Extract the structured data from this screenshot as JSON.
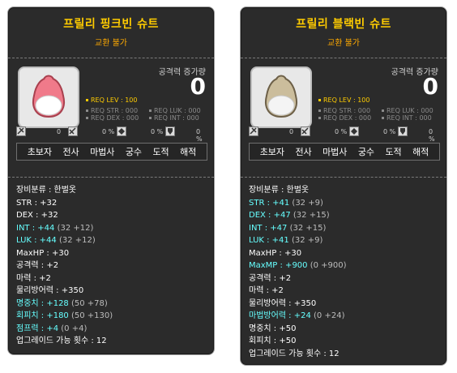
{
  "cards": [
    {
      "title": "프릴리 핑크빈 슈트",
      "trade": "교환 불가",
      "attack_label": "공격력 증가량",
      "attack_value": "0",
      "req_lev": "REQ LEV : 100",
      "req_str": "REQ STR : 000",
      "req_dex": "REQ DEX : 000",
      "req_luk": "REQ LUK : 000",
      "req_int": "REQ INT : 000",
      "icon_values": [
        "0",
        "0 %",
        "0 %",
        "0 %"
      ],
      "icon_names": [
        "hit-icon",
        "speed-icon",
        "defense-icon",
        "shield-icon"
      ],
      "item_color": "#f07a8a",
      "jobs": [
        "초보자",
        "전사",
        "마법사",
        "궁수",
        "도적",
        "해적"
      ],
      "stats": [
        {
          "label": "장비분류 : 한벌옷",
          "extra": "",
          "blue": false
        },
        {
          "label": "STR : +32",
          "extra": "",
          "blue": false
        },
        {
          "label": "DEX : +32",
          "extra": "",
          "blue": false
        },
        {
          "label": "INT : +44",
          "extra": "(32 +12)",
          "blue": true
        },
        {
          "label": "LUK : +44",
          "extra": "(32 +12)",
          "blue": true
        },
        {
          "label": "MaxHP : +30",
          "extra": "",
          "blue": false
        },
        {
          "label": "공격력 : +2",
          "extra": "",
          "blue": false
        },
        {
          "label": "마력 : +2",
          "extra": "",
          "blue": false
        },
        {
          "label": "물리방어력 : +350",
          "extra": "",
          "blue": false
        },
        {
          "label": "명중치 : +128",
          "extra": "(50 +78)",
          "blue": true
        },
        {
          "label": "회피치 : +180",
          "extra": "(50 +130)",
          "blue": true
        },
        {
          "label": "점프력 : +4",
          "extra": "(0 +4)",
          "blue": true
        },
        {
          "label": "업그레이드 가능 횟수 : 12",
          "extra": "",
          "blue": false
        }
      ]
    },
    {
      "title": "프릴리 블랙빈 슈트",
      "trade": "교환 불가",
      "attack_label": "공격력 증가량",
      "attack_value": "0",
      "req_lev": "REQ LEV : 100",
      "req_str": "REQ STR : 000",
      "req_dex": "REQ DEX : 000",
      "req_luk": "REQ LUK : 000",
      "req_int": "REQ INT : 000",
      "icon_values": [
        "0",
        "0 %",
        "0 %",
        "0 %"
      ],
      "icon_names": [
        "hit-icon",
        "speed-icon",
        "defense-icon",
        "shield-icon"
      ],
      "item_color": "#d8c8a8",
      "jobs": [
        "초보자",
        "전사",
        "마법사",
        "궁수",
        "도적",
        "해적"
      ],
      "stats": [
        {
          "label": "장비분류 : 한벌옷",
          "extra": "",
          "blue": false
        },
        {
          "label": "STR : +41",
          "extra": "(32 +9)",
          "blue": true
        },
        {
          "label": "DEX : +47",
          "extra": "(32 +15)",
          "blue": true
        },
        {
          "label": "INT : +47",
          "extra": "(32 +15)",
          "blue": true
        },
        {
          "label": "LUK : +41",
          "extra": "(32 +9)",
          "blue": true
        },
        {
          "label": "MaxHP : +30",
          "extra": "",
          "blue": false
        },
        {
          "label": "MaxMP : +900",
          "extra": "(0 +900)",
          "blue": true
        },
        {
          "label": "공격력 : +2",
          "extra": "",
          "blue": false
        },
        {
          "label": "마력 : +2",
          "extra": "",
          "blue": false
        },
        {
          "label": "물리방어력 : +350",
          "extra": "",
          "blue": false
        },
        {
          "label": "마법방어력 : +24",
          "extra": "(0 +24)",
          "blue": true
        },
        {
          "label": "명중치 : +50",
          "extra": "",
          "blue": false
        },
        {
          "label": "회피치 : +50",
          "extra": "",
          "blue": false
        },
        {
          "label": "업그레이드 가능 횟수 : 12",
          "extra": "",
          "blue": false
        }
      ]
    }
  ]
}
